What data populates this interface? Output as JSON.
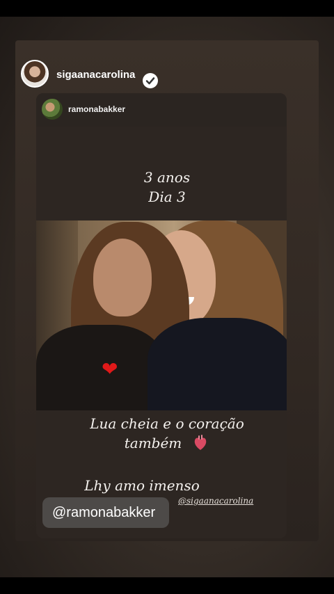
{
  "header": {
    "username": "sigaanacarolina",
    "verified_icon": "verified-badge-icon"
  },
  "reshared_post": {
    "username": "ramonabakker"
  },
  "story_text": {
    "line1": "3 anos",
    "line2": "Dia 3",
    "caption_line1": "Lua cheia e o coração",
    "caption_line2": "também",
    "caption_line3": "Lhy amo imenso"
  },
  "stickers": {
    "heart_icon": "red-heart-icon",
    "anatomical_heart_icon": "anatomical-heart-icon",
    "mention_main": "@ramonabakker",
    "mention_small": "@sigaanacarolina"
  },
  "colors": {
    "background": "#2c2520",
    "text": "#f5f2ef",
    "heart": "#e01919",
    "sticker_bg": "#4d4a48"
  }
}
